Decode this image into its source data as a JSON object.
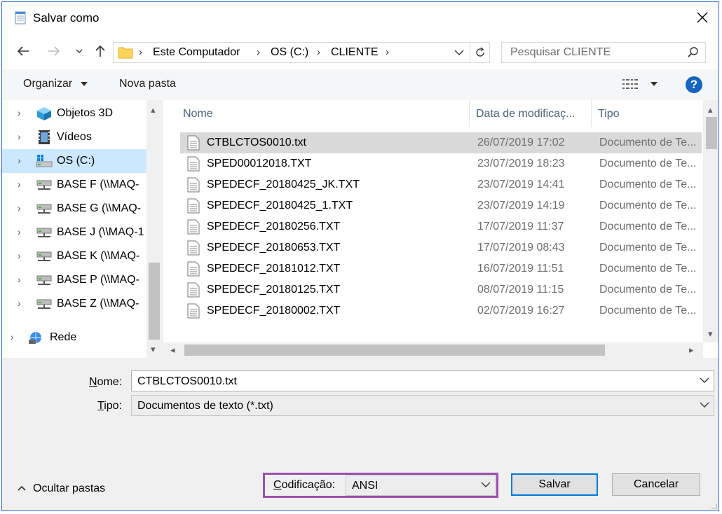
{
  "window": {
    "title": "Salvar como"
  },
  "address": {
    "breadcrumbs": [
      "Este Computador",
      "OS (C:)",
      "CLIENTE"
    ],
    "search_placeholder": "Pesquisar CLIENTE"
  },
  "toolbar": {
    "organize_label": "Organizar",
    "new_folder_label": "Nova pasta"
  },
  "nav": {
    "items": [
      {
        "label": "Objetos 3D",
        "icon": "3d-objects-icon"
      },
      {
        "label": "Vídeos",
        "icon": "videos-icon"
      },
      {
        "label": "OS (C:)",
        "icon": "drive-icon",
        "selected": true
      },
      {
        "label": "BASE F (\\\\MAQ-",
        "icon": "network-drive-icon"
      },
      {
        "label": "BASE G (\\\\MAQ-",
        "icon": "network-drive-icon"
      },
      {
        "label": "BASE J (\\\\MAQ-1",
        "icon": "network-drive-icon"
      },
      {
        "label": "BASE K (\\\\MAQ-",
        "icon": "network-drive-icon"
      },
      {
        "label": "BASE P (\\\\MAQ-",
        "icon": "network-drive-icon"
      },
      {
        "label": "BASE Z (\\\\MAQ-",
        "icon": "network-drive-icon"
      }
    ],
    "network_label": "Rede"
  },
  "files": {
    "columns": {
      "name": "Nome",
      "date": "Data de modificaç...",
      "type": "Tipo"
    },
    "rows": [
      {
        "name": "CTBLCTOS0010.txt",
        "date": "26/07/2019 17:02",
        "type": "Documento de Te...",
        "selected": true
      },
      {
        "name": "SPED00012018.TXT",
        "date": "23/07/2019 18:23",
        "type": "Documento de Te..."
      },
      {
        "name": "SPEDECF_20180425_JK.TXT",
        "date": "23/07/2019 14:41",
        "type": "Documento de Te..."
      },
      {
        "name": "SPEDECF_20180425_1.TXT",
        "date": "23/07/2019 14:19",
        "type": "Documento de Te..."
      },
      {
        "name": "SPEDECF_20180256.TXT",
        "date": "17/07/2019 11:37",
        "type": "Documento de Te..."
      },
      {
        "name": "SPEDECF_20180653.TXT",
        "date": "17/07/2019 08:43",
        "type": "Documento de Te..."
      },
      {
        "name": "SPEDECF_20181012.TXT",
        "date": "16/07/2019 11:51",
        "type": "Documento de Te..."
      },
      {
        "name": "SPEDECF_20180125.TXT",
        "date": "08/07/2019 11:15",
        "type": "Documento de Te..."
      },
      {
        "name": "SPEDECF_20180002.TXT",
        "date": "02/07/2019 16:27",
        "type": "Documento de Te..."
      }
    ]
  },
  "form": {
    "name_label_u": "N",
    "name_label_rest": "ome:",
    "name_value": "CTBLCTOS0010.txt",
    "type_label_u": "T",
    "type_label_rest": "ipo:",
    "type_value": "Documentos de texto (*.txt)",
    "encoding_label_u": "C",
    "encoding_label_rest": "odificação:",
    "encoding_value": "ANSI"
  },
  "footer": {
    "hide_folders_label": "Ocultar pastas",
    "save_label": "Salvar",
    "cancel_label": "Cancelar"
  },
  "colors": {
    "accent": "#0078d7",
    "selection": "#cce8ff",
    "highlight_box": "#9b4fad"
  }
}
